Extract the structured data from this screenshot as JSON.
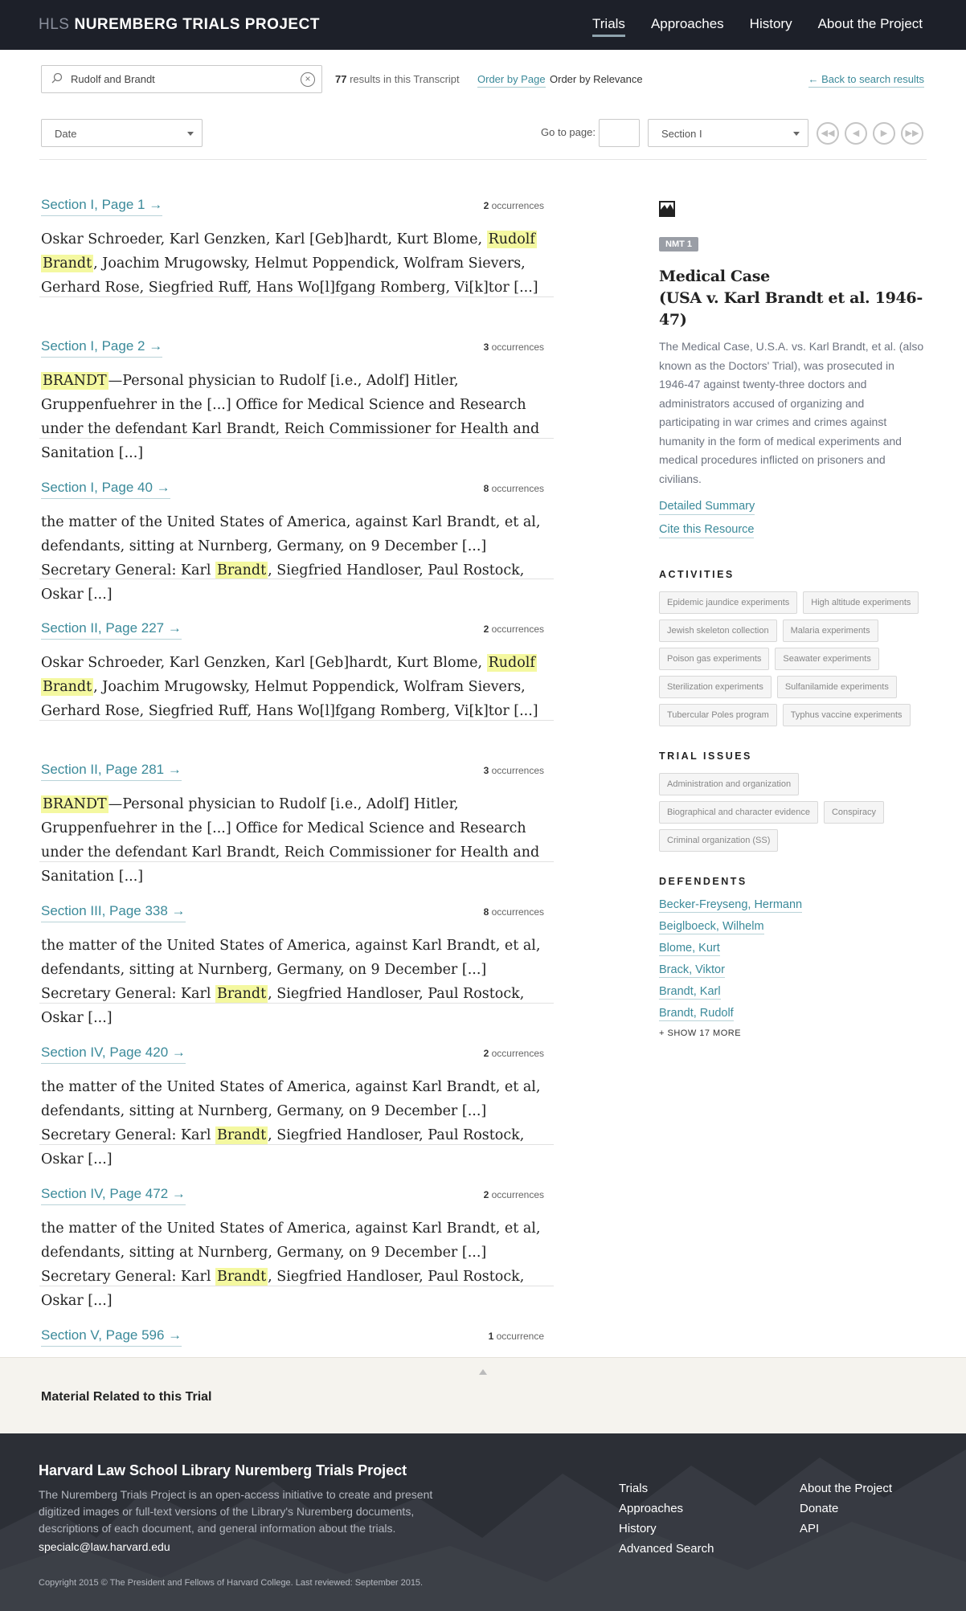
{
  "header": {
    "brand_prefix": "HLS",
    "brand_name": "NUREMBERG TRIALS PROJECT",
    "nav": [
      "Trials",
      "Approaches",
      "History",
      "About the Project"
    ]
  },
  "search": {
    "value": "Rudolf and Brandt",
    "result_count": "77",
    "result_suffix": "results in this Transcript",
    "order_page": "Order by Page",
    "order_relevance": "Order by Relevance",
    "back_link": "← Back to search results"
  },
  "filters": {
    "date_label": "Date",
    "goto_label": "Go to page:",
    "section_selected": "Section I"
  },
  "results": [
    {
      "title": "Section I, Page 1 →",
      "count": "2",
      "unit": "occurrences",
      "parts": [
        [
          "Oskar Schroeder, Karl Genzken, Karl [Geb]hardt, Kurt Blome, ",
          ""
        ],
        [
          "Rudolf",
          "hl"
        ],
        [
          " ",
          ""
        ],
        [
          "Brandt",
          "hl"
        ],
        [
          ", Joachim Mrugowsky, Helmut Poppendick, Wolfram Sievers, Gerhard Rose, Siegfried Ruff, Hans Wo[l]fgang Romberg, Vi[k]tor [...]",
          ""
        ]
      ]
    },
    {
      "title": "Section I, Page 2 →",
      "count": "3",
      "unit": "occurrences",
      "parts": [
        [
          "BRANDT",
          "hl"
        ],
        [
          "—Personal physician to Rudolf [i.e., Adolf] Hitler, Gruppenfuehrer in the  [...] Office for Medical Science and Research under the defendant Karl Brandt, Reich Commissioner for Health and Sanitation [...]",
          ""
        ]
      ]
    },
    {
      "title": "Section I, Page 40 →",
      "count": "8",
      "unit": "occurrences",
      "parts": [
        [
          "the matter of the United States of America, against Karl Brandt, et al, defendants, sitting at Nurnberg, Germany, on 9 December [...] Secretary General: Karl ",
          ""
        ],
        [
          "Brandt",
          "hl"
        ],
        [
          ", Siegfried Handloser, Paul Rostock, Oskar [...]",
          ""
        ]
      ]
    },
    {
      "title": "Section II, Page 227 →",
      "count": "2",
      "unit": "occurrences",
      "parts": [
        [
          "Oskar Schroeder, Karl Genzken, Karl [Geb]hardt, Kurt Blome, ",
          ""
        ],
        [
          "Rudolf",
          "hl"
        ],
        [
          " ",
          ""
        ],
        [
          "Brandt",
          "hl"
        ],
        [
          ", Joachim Mrugowsky, Helmut Poppendick, Wolfram Sievers, Gerhard Rose, Siegfried Ruff, Hans Wo[l]fgang Romberg, Vi[k]tor [...]",
          ""
        ]
      ]
    },
    {
      "title": "Section II, Page 281 →",
      "count": "3",
      "unit": "occurrences",
      "parts": [
        [
          "BRANDT",
          "hl"
        ],
        [
          "—Personal physician to Rudolf [i.e., Adolf] Hitler, Gruppenfuehrer in the  [...] Office for Medical Science and Research under the defendant Karl Brandt, Reich Commissioner for Health and Sanitation [...]",
          ""
        ]
      ]
    },
    {
      "title": "Section III, Page 338 →",
      "count": "8",
      "unit": "occurrences",
      "parts": [
        [
          "the matter of the United States of America, against Karl Brandt, et al, defendants, sitting at Nurnberg, Germany, on 9 December [...] Secretary General: Karl ",
          ""
        ],
        [
          "Brandt",
          "hl"
        ],
        [
          ", Siegfried Handloser, Paul Rostock, Oskar [...]",
          ""
        ]
      ]
    },
    {
      "title": "Section IV, Page 420 →",
      "count": "2",
      "unit": "occurrences",
      "parts": [
        [
          "the matter of the United States of America, against Karl Brandt, et al, defendants, sitting at Nurnberg, Germany, on 9 December [...] Secretary General: Karl ",
          ""
        ],
        [
          "Brandt",
          "hl"
        ],
        [
          ", Siegfried Handloser, Paul Rostock, Oskar [...]",
          ""
        ]
      ]
    },
    {
      "title": "Section IV, Page 472 →",
      "count": "2",
      "unit": "occurrences",
      "parts": [
        [
          "the matter of the United States of America, against Karl Brandt, et al, defendants, sitting at Nurnberg, Germany, on 9 December [...] Secretary General: Karl ",
          ""
        ],
        [
          "Brandt",
          "hl"
        ],
        [
          ", Siegfried Handloser, Paul Rostock, Oskar [...]",
          ""
        ]
      ]
    },
    {
      "title": "Section V, Page 596 →",
      "count": "1",
      "unit": "occurrence",
      "parts": []
    }
  ],
  "sidebar": {
    "badge": "NMT 1",
    "title_line1": "Medical Case",
    "title_line2": "(USA v. Karl Brandt et al. 1946-47)",
    "description": "The Medical Case, U.S.A. vs. Karl Brandt, et al. (also known as the Doctors' Trial), was prosecuted in 1946-47 against twenty-three doctors and administrators accused of organizing and participating in war crimes and crimes against humanity in the form of medical experiments and medical procedures inflicted on prisoners and civilians.",
    "detailed_summary": "Detailed Summary",
    "cite": "Cite this Resource",
    "activities_heading": "ACTIVITIES",
    "activities": [
      "Epidemic jaundice experiments",
      "High altitude experiments",
      "Jewish skeleton collection",
      "Malaria experiments",
      "Poison gas experiments",
      "Seawater experiments",
      "Sterilization experiments",
      "Sulfanilamide experiments",
      "Tubercular Poles program",
      "Typhus vaccine experiments"
    ],
    "issues_heading": "TRIAL ISSUES",
    "issues": [
      "Administration and organization",
      "Biographical and character evidence",
      "Conspiracy",
      "Criminal organization (SS)"
    ],
    "defendants_heading": "DEFENDENTS",
    "defendants": [
      "Becker-Freyseng, Hermann",
      "Beiglboeck, Wilhelm",
      "Blome, Kurt",
      "Brack, Viktor",
      "Brandt, Karl",
      "Brandt, Rudolf"
    ],
    "show_more": "+ SHOW 17 MORE"
  },
  "related": {
    "label": "Material Related to this Trial"
  },
  "footer": {
    "title": "Harvard Law School Library Nuremberg Trials Project",
    "description": "The Nuremberg Trials Project is an open-access initiative to create and present digitized images or full-text versions of the Library's Nuremberg documents, descriptions of each document, and general information about the trials.",
    "email": "specialc@law.harvard.edu",
    "copyright": "Copyright 2015 © The President and Fellows of Harvard College. Last reviewed: September 2015.",
    "col1": [
      "Trials",
      "Approaches",
      "History",
      "Advanced Search"
    ],
    "col2": [
      "About the Project",
      "Donate",
      "API"
    ]
  },
  "colors": {
    "accent": "#3b8a9a",
    "header_bg": "#1d2029",
    "highlight": "#f4f8a0"
  }
}
